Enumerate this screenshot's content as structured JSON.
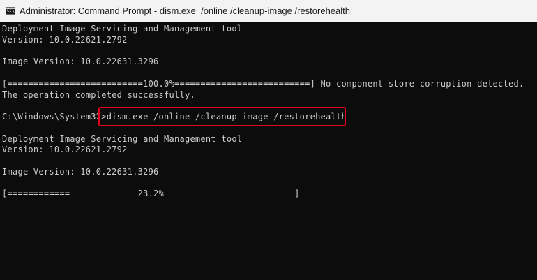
{
  "window": {
    "title": "Administrator: Command Prompt - dism.exe  /online /cleanup-image /restorehealth",
    "icon": "command-prompt-icon",
    "icon_glyph": "C:\\"
  },
  "console": {
    "lines": [
      "Deployment Image Servicing and Management tool",
      "Version: 10.0.22621.2792",
      "",
      "Image Version: 10.0.22631.3296",
      "",
      "[==========================100.0%==========================] No component store corruption detected.",
      "The operation completed successfully.",
      "",
      "C:\\Windows\\System32>dism.exe /online /cleanup-image /restorehealth",
      "",
      "Deployment Image Servicing and Management tool",
      "Version: 10.0.22621.2792",
      "",
      "Image Version: 10.0.22631.3296",
      "",
      "[============             23.2%                         ]"
    ]
  },
  "highlight": {
    "color": "#e0001b",
    "target": "dism.exe /online /cleanup-image /restorehealth"
  },
  "progress": {
    "percent": 23.2
  },
  "colors": {
    "console_background": "#0c0c0c",
    "console_text": "#cccccc",
    "titlebar_background": "#f3f3f3"
  }
}
